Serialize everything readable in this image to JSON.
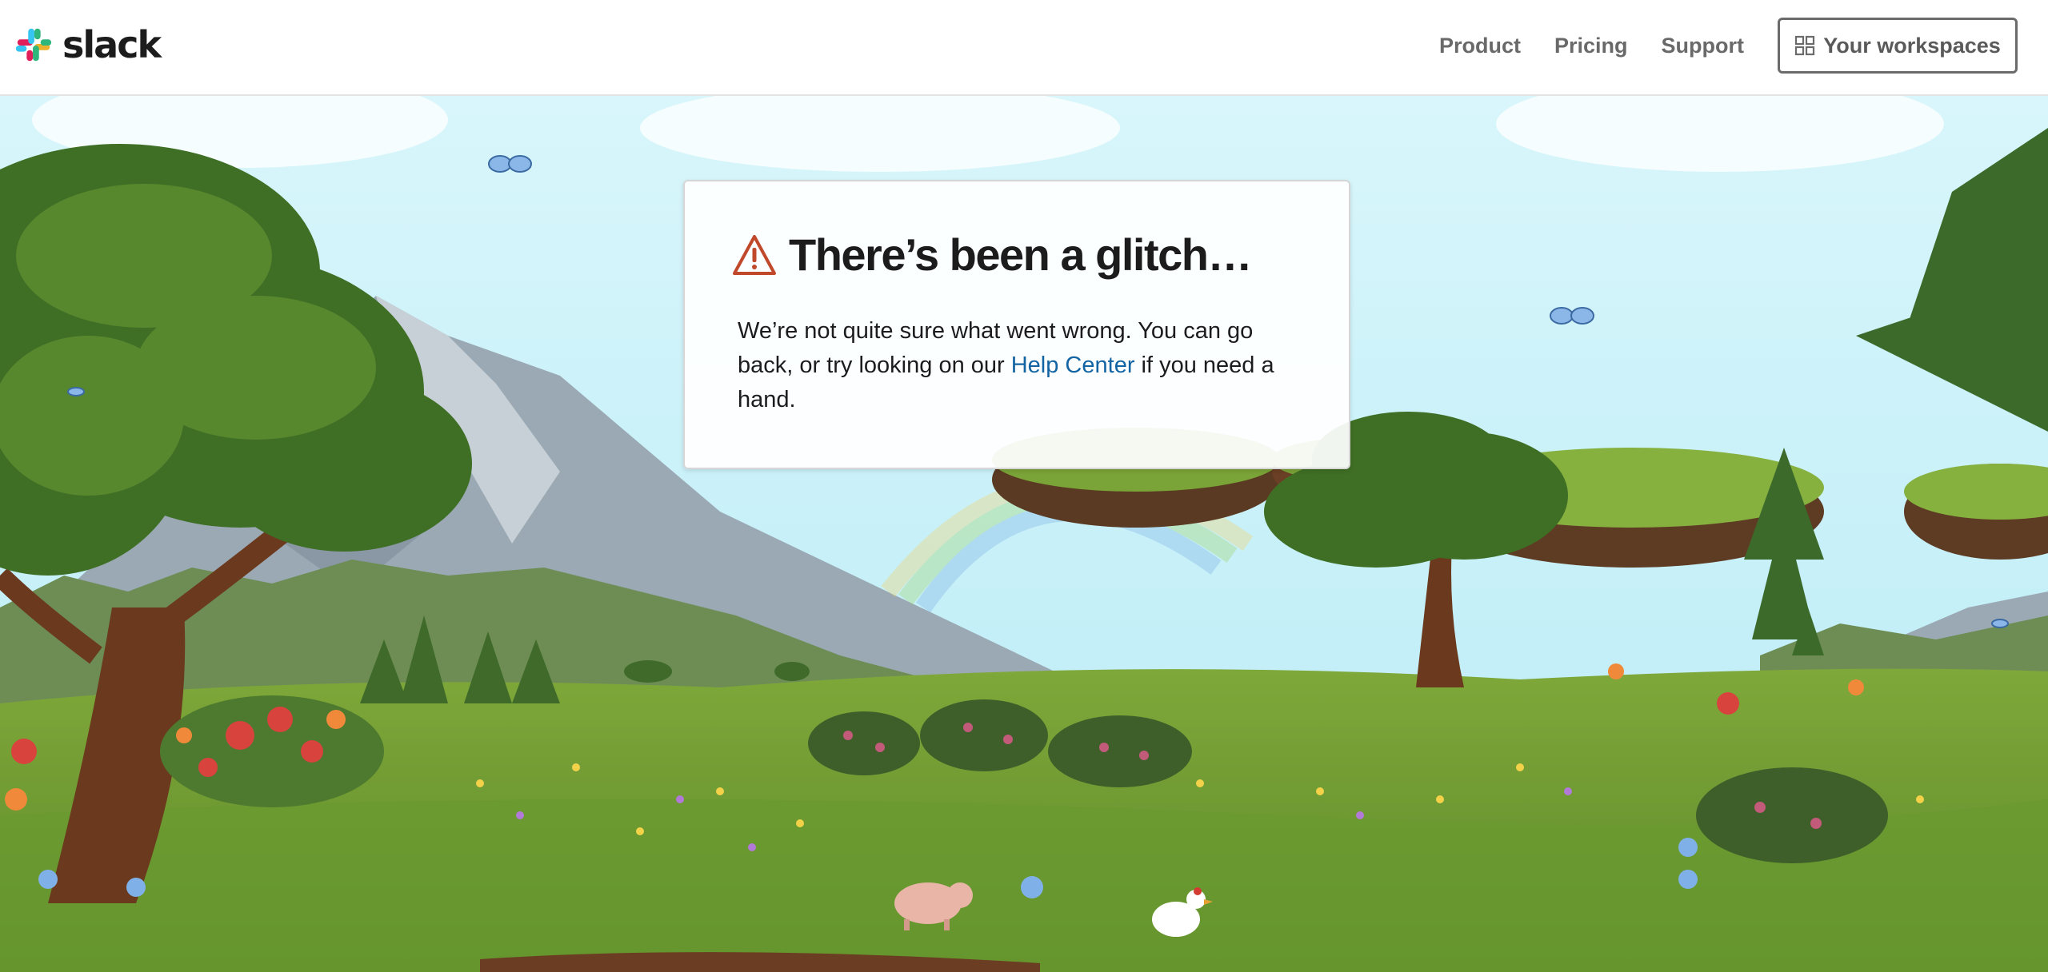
{
  "header": {
    "logo_text": "slack",
    "nav": [
      {
        "label": "Product"
      },
      {
        "label": "Pricing"
      },
      {
        "label": "Support"
      }
    ],
    "workspaces_label": "Your workspaces"
  },
  "error": {
    "title": "There’s been a glitch…",
    "body_before": "We’re not quite sure what went wrong. You can go back, or try looking on our ",
    "link_label": "Help Center",
    "body_after": " if you need a hand."
  },
  "colors": {
    "brand_dark": "#1d1c1d",
    "link": "#1264a3",
    "warning": "#c0492b",
    "slack_blue": "#36c5f0",
    "slack_green": "#2eb67d",
    "slack_yellow": "#ecb22e",
    "slack_red": "#e01e5a"
  },
  "icons": {
    "logo": "slack-hash-logo",
    "workspaces": "grid-icon",
    "warning": "warning-triangle-icon"
  }
}
